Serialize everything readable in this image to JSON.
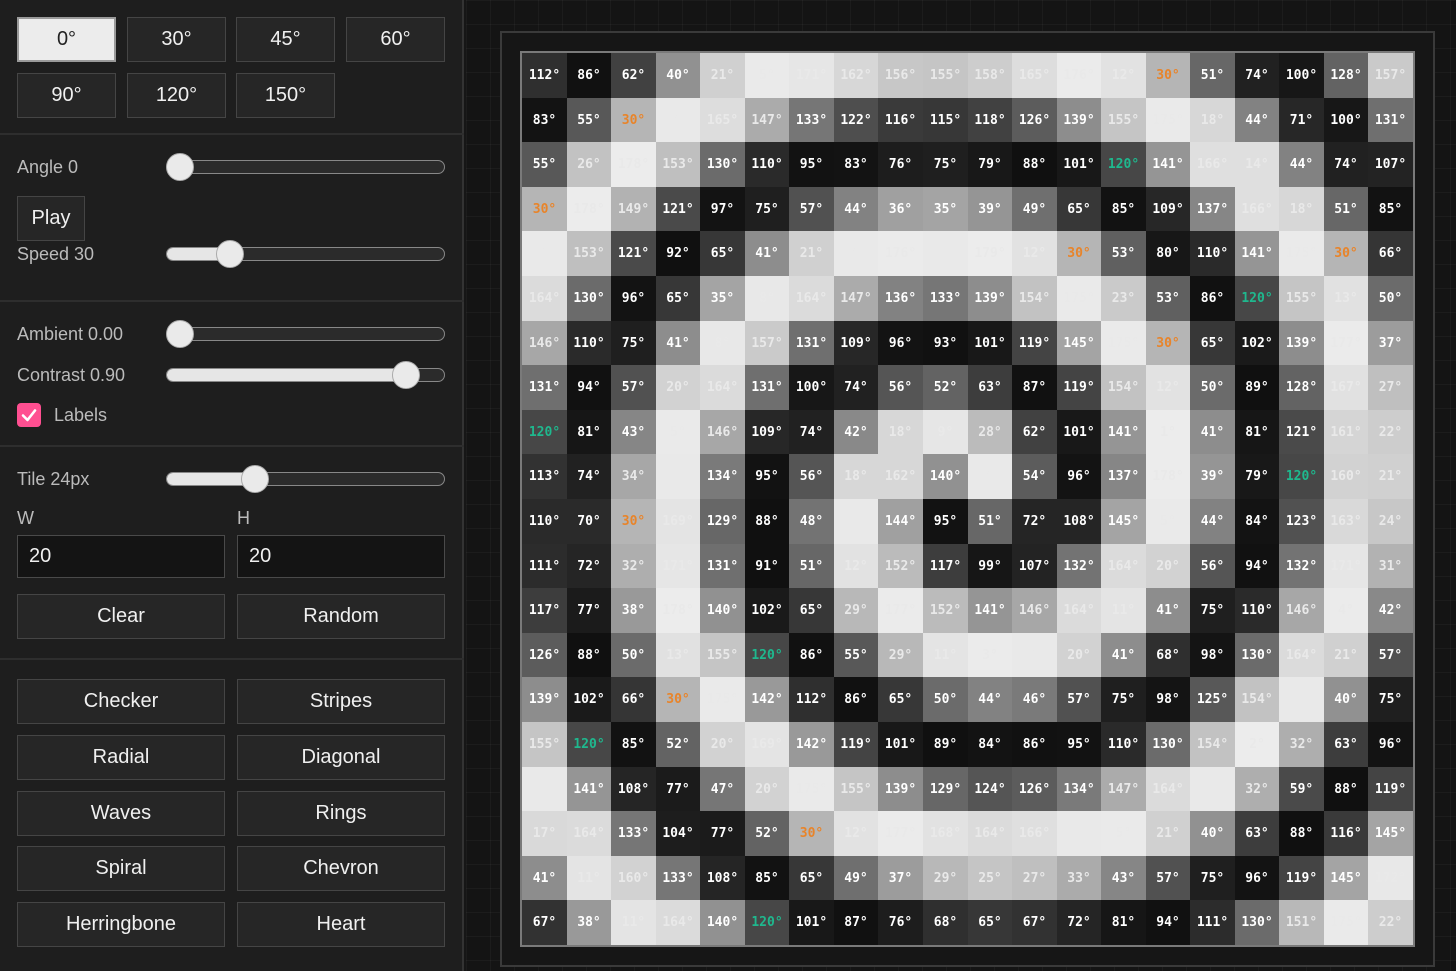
{
  "angle_presets": [
    "0°",
    "30°",
    "45°",
    "60°",
    "90°",
    "120°",
    "150°"
  ],
  "angle_presets_active": 0,
  "controls": {
    "angle_label": "Angle 0",
    "angle_value": 0,
    "angle_max": 180,
    "play_label": "Play",
    "speed_label": "Speed 30",
    "speed_fraction": 0.2,
    "ambient_label": "Ambient 0.00",
    "ambient_value": 0.0,
    "contrast_label": "Contrast 0.90",
    "contrast_value": 0.9,
    "labels_label": "Labels",
    "labels_checked": true,
    "tile_label": "Tile 24px",
    "tile_fraction": 0.3
  },
  "size": {
    "w_label": "W",
    "h_label": "H",
    "w_value": "20",
    "h_value": "20"
  },
  "actions": {
    "clear_label": "Clear",
    "random_label": "Random"
  },
  "patterns": [
    "Checker",
    "Stripes",
    "Radial",
    "Diagonal",
    "Waves",
    "Rings",
    "Spiral",
    "Chevron",
    "Herringbone",
    "Heart"
  ],
  "colors": {
    "accent_checkbox": "#ff4f91",
    "label_30": "#e8842a",
    "label_120": "#1fb88e",
    "label_dark_cell": "#ffffff",
    "label_light_cell": "#e9e9e9"
  },
  "grid": {
    "angles": [
      [
        112,
        86,
        62,
        40,
        21,
        5,
        171,
        162,
        156,
        155,
        158,
        165,
        176,
        12,
        30,
        51,
        74,
        100,
        128,
        157
      ],
      [
        83,
        55,
        30,
        6,
        165,
        147,
        133,
        122,
        116,
        115,
        118,
        126,
        139,
        155,
        175,
        18,
        44,
        71,
        100,
        131
      ],
      [
        55,
        26,
        178,
        153,
        130,
        110,
        95,
        83,
        76,
        75,
        79,
        88,
        101,
        120,
        141,
        166,
        14,
        44,
        74,
        107
      ],
      [
        30,
        178,
        149,
        121,
        97,
        75,
        57,
        44,
        36,
        35,
        39,
        49,
        65,
        85,
        109,
        137,
        166,
        18,
        51,
        85
      ],
      [
        6,
        153,
        121,
        92,
        65,
        41,
        21,
        6,
        176,
        173,
        179,
        12,
        30,
        53,
        80,
        110,
        141,
        175,
        30,
        66
      ],
      [
        164,
        130,
        96,
        65,
        35,
        8,
        164,
        147,
        136,
        133,
        139,
        154,
        175,
        23,
        53,
        86,
        120,
        155,
        13,
        50
      ],
      [
        146,
        110,
        75,
        41,
        8,
        157,
        131,
        109,
        96,
        93,
        101,
        119,
        145,
        175,
        30,
        65,
        102,
        139,
        177,
        37
      ],
      [
        131,
        94,
        57,
        20,
        164,
        131,
        100,
        74,
        56,
        52,
        63,
        87,
        119,
        154,
        12,
        50,
        89,
        128,
        167,
        27
      ],
      [
        120,
        81,
        43,
        5,
        146,
        109,
        74,
        42,
        18,
        9,
        28,
        62,
        101,
        141,
        1,
        41,
        81,
        121,
        161,
        22
      ],
      [
        113,
        74,
        34,
        173,
        134,
        95,
        56,
        18,
        162,
        140,
        6,
        54,
        96,
        137,
        178,
        39,
        79,
        120,
        160,
        21
      ],
      [
        110,
        70,
        30,
        169,
        129,
        88,
        48,
        7,
        144,
        95,
        51,
        72,
        108,
        145,
        5,
        44,
        84,
        123,
        163,
        24
      ],
      [
        111,
        72,
        32,
        171,
        131,
        91,
        51,
        12,
        152,
        117,
        99,
        107,
        132,
        164,
        20,
        56,
        94,
        132,
        171,
        31
      ],
      [
        117,
        77,
        38,
        178,
        140,
        102,
        65,
        29,
        177,
        152,
        141,
        146,
        164,
        11,
        41,
        75,
        110,
        146,
        4,
        42
      ],
      [
        126,
        88,
        50,
        13,
        155,
        120,
        86,
        55,
        29,
        11,
        3,
        6,
        20,
        41,
        68,
        98,
        130,
        164,
        21,
        57
      ],
      [
        139,
        102,
        66,
        30,
        175,
        142,
        112,
        86,
        65,
        50,
        44,
        46,
        57,
        75,
        98,
        125,
        154,
        7,
        40,
        75
      ],
      [
        155,
        120,
        85,
        52,
        20,
        169,
        142,
        119,
        101,
        89,
        84,
        86,
        95,
        110,
        130,
        154,
        2,
        32,
        63,
        96
      ],
      [
        174,
        141,
        108,
        77,
        47,
        20,
        175,
        155,
        139,
        129,
        124,
        126,
        134,
        147,
        164,
        7,
        32,
        59,
        88,
        119
      ],
      [
        17,
        164,
        133,
        104,
        77,
        52,
        30,
        12,
        177,
        168,
        164,
        166,
        173,
        5,
        21,
        40,
        63,
        88,
        116,
        145
      ],
      [
        41,
        11,
        160,
        133,
        108,
        85,
        65,
        49,
        37,
        29,
        25,
        27,
        33,
        43,
        57,
        75,
        96,
        119,
        145,
        172
      ],
      [
        67,
        38,
        11,
        164,
        140,
        120,
        101,
        87,
        76,
        68,
        65,
        67,
        72,
        81,
        94,
        111,
        130,
        151,
        175,
        22
      ]
    ]
  }
}
